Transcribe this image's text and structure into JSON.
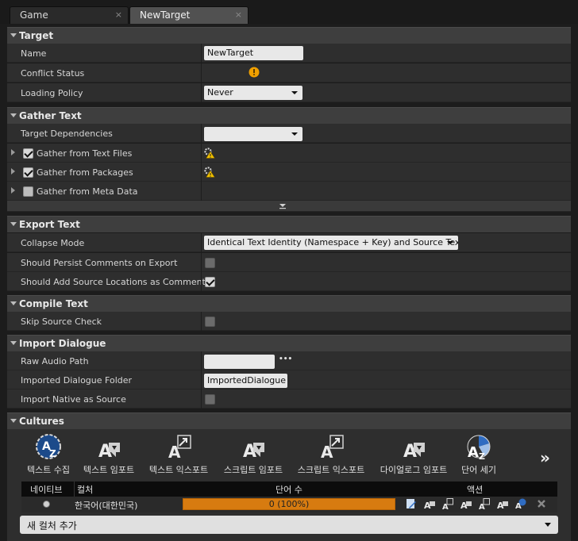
{
  "tabs": [
    {
      "label": "Game",
      "close": "×"
    },
    {
      "label": "NewTarget",
      "close": "×"
    }
  ],
  "target": {
    "title": "Target",
    "name_label": "Name",
    "name_value": "NewTarget",
    "conflict_label": "Conflict Status",
    "loading_label": "Loading Policy",
    "loading_value": "Never"
  },
  "gather": {
    "title": "Gather Text",
    "deps_label": "Target Dependencies",
    "deps_value": "",
    "items": [
      {
        "label": "Gather from Text Files",
        "checked": true
      },
      {
        "label": "Gather from Packages",
        "checked": true
      },
      {
        "label": "Gather from Meta Data",
        "checked": false
      }
    ]
  },
  "export": {
    "title": "Export Text",
    "collapse_label": "Collapse Mode",
    "collapse_value": "Identical Text Identity (Namespace + Key) and Source Text",
    "persist_label": "Should Persist Comments on Export",
    "persist_checked": false,
    "addsrc_label": "Should Add Source Locations as Comments",
    "addsrc_checked": true
  },
  "compile": {
    "title": "Compile Text",
    "skip_label": "Skip Source Check",
    "skip_checked": false
  },
  "dialogue": {
    "title": "Import Dialogue",
    "raw_label": "Raw Audio Path",
    "raw_value": "",
    "raw_more": "•••",
    "folder_label": "Imported Dialogue Folder",
    "folder_value": "ImportedDialogue",
    "native_label": "Import Native as Source",
    "native_checked": false
  },
  "cultures": {
    "title": "Cultures",
    "toolbar": [
      "텍스트 수집",
      "텍스트 임포트",
      "텍스트 익스포트",
      "스크립트 임포트",
      "스크립트 익스포트",
      "다이얼로그 임포트",
      "단어 세기"
    ],
    "more": "»",
    "columns": {
      "native": "네이티브",
      "culture": "컬처",
      "word_count": "단어 수",
      "actions": "액션"
    },
    "rows": [
      {
        "culture": "한국어(대한민국)",
        "progress": 1.0,
        "progress_label": "0 (100%)"
      }
    ],
    "add_label": "새 컬처 추가"
  },
  "colors": {
    "accent": "#d77b10",
    "warning": "#f0a000"
  }
}
